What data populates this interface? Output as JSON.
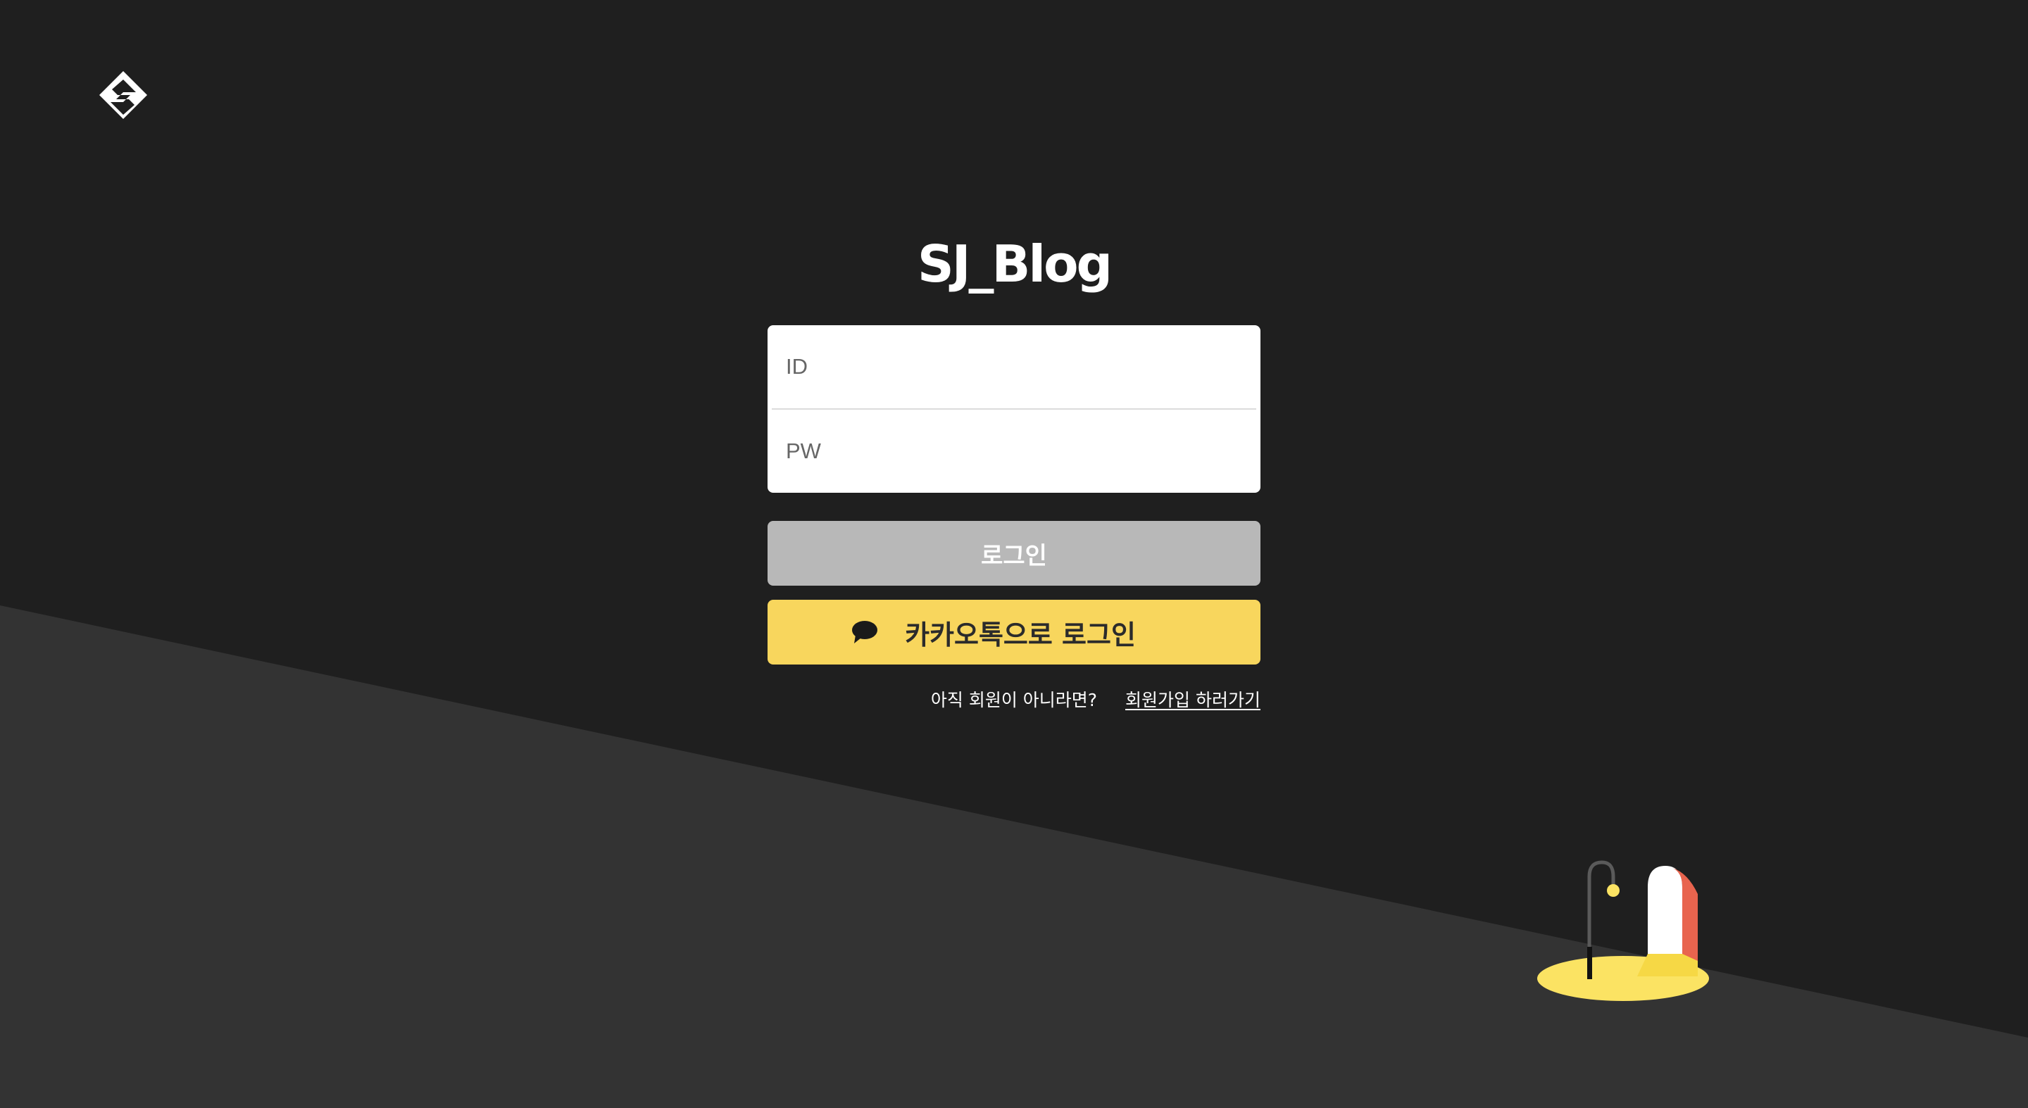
{
  "brand": {
    "logo_icon": "sj-diamond-logo-icon",
    "title": "SJ_Blog"
  },
  "form": {
    "id_placeholder": "ID",
    "pw_placeholder": "PW",
    "login_label": "로그인",
    "kakao_label": "카카오톡으로 로그인",
    "kakao_icon": "speech-bubble-icon"
  },
  "signup": {
    "question": "아직 회원이 아니라면?",
    "link_label": "회원가입 하러가기"
  },
  "colors": {
    "background": "#1f1f1f",
    "background_diagonal": "#333333",
    "login_button": "#b8b8b8",
    "kakao_button": "#f8d65d",
    "accent_red": "#e8644e"
  }
}
